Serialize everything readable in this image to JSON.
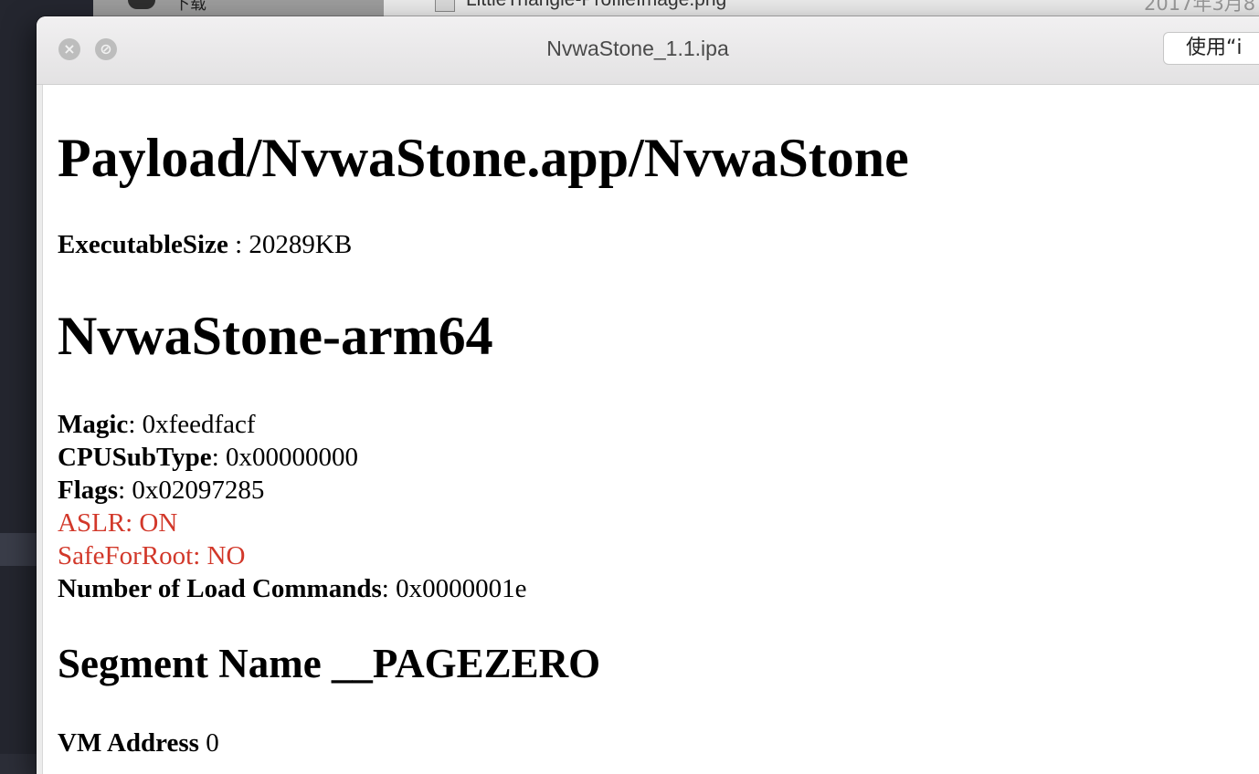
{
  "background": {
    "download_label": "下载",
    "file_name": "LittleTriangle-ProfileImage.png",
    "file_date": "2017年3月8"
  },
  "window": {
    "title": "NvwaStone_1.1.ipa",
    "open_with_label": "使用“i",
    "close_symbol": "×",
    "fullscreen_symbol": "⊘"
  },
  "doc": {
    "path_heading": "Payload/NvwaStone.app/NvwaStone",
    "exe_size_label": "ExecutableSize",
    "exe_size_sep": " : ",
    "exe_size_value": "20289KB",
    "arch_heading": "NvwaStone-arm64",
    "magic_label": "Magic",
    "magic_value": ": 0xfeedfacf",
    "cpu_label": "CPUSubType",
    "cpu_value": ": 0x00000000",
    "flags_label": "Flags",
    "flags_value": ": 0x02097285",
    "aslr_text": "ASLR: ON",
    "safe_root_text": "SafeForRoot: NO",
    "load_cmds_label": "Number of Load Commands",
    "load_cmds_value": ": 0x0000001e",
    "segment_heading": "Segment Name __PAGEZERO",
    "vm_label": "VM Address",
    "vm_value": " 0"
  },
  "colors": {
    "warning_text": "#d2382a",
    "content_bg": "#ffffff",
    "titlebar_bg": "#e8e7e8"
  }
}
